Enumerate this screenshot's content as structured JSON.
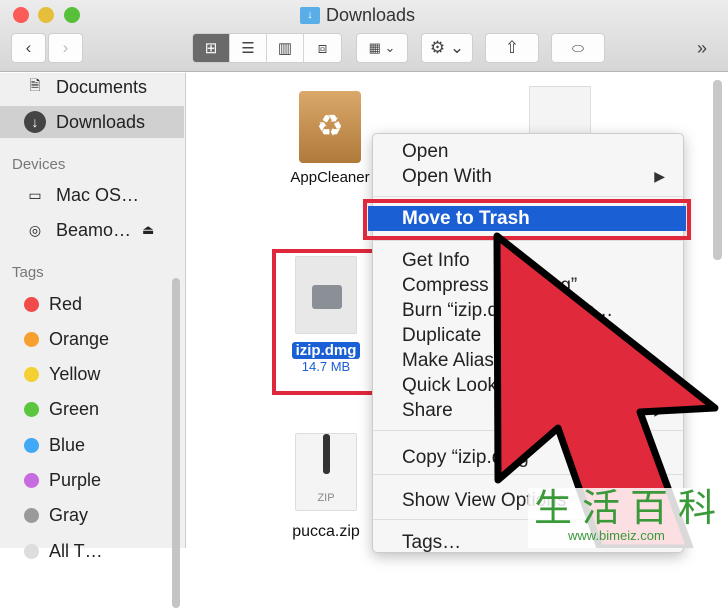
{
  "window": {
    "title": "Downloads",
    "traffic_colors": [
      "#fc5b57",
      "#e5bf3c",
      "#57c038"
    ]
  },
  "toolbar": {
    "back": "‹",
    "forward": "›",
    "views": [
      "icon-view",
      "list-view",
      "column-view",
      "cover-flow-view"
    ],
    "arrange": "arrange-menu",
    "action": "gear-menu",
    "share": "share",
    "tag": "tag",
    "more": "»"
  },
  "sidebar": {
    "favorites": [
      {
        "label": "Documents",
        "icon": "documents-icon"
      },
      {
        "label": "Downloads",
        "icon": "downloads-icon",
        "selected": true
      }
    ],
    "devices_header": "Devices",
    "devices": [
      {
        "label": "Mac OS…",
        "icon": "hard-drive-icon"
      },
      {
        "label": "Beamo…",
        "icon": "disc-icon",
        "eject": true
      }
    ],
    "tags_header": "Tags",
    "tags": [
      {
        "label": "Red",
        "color": "#f04a4a"
      },
      {
        "label": "Orange",
        "color": "#f7a030"
      },
      {
        "label": "Yellow",
        "color": "#f5d033"
      },
      {
        "label": "Green",
        "color": "#5cc640"
      },
      {
        "label": "Blue",
        "color": "#3fa9f5"
      },
      {
        "label": "Purple",
        "color": "#c86be0"
      },
      {
        "label": "Gray",
        "color": "#9a9a9a"
      },
      {
        "label": "All T…",
        "color": "#dddddd"
      }
    ]
  },
  "files": [
    {
      "name": "AppCleaner"
    },
    {
      "name": "izip.dmg",
      "size": "14.7 MB",
      "selected": true
    },
    {
      "name": "pucca.zip",
      "badge": "ZIP"
    }
  ],
  "context_menu": {
    "items": [
      {
        "label": "Open"
      },
      {
        "label": "Open With",
        "submenu": true
      },
      {
        "label": "Move to Trash",
        "highlighted": true
      },
      {
        "label": "Get Info"
      },
      {
        "label": "Compress “izip.dmg”"
      },
      {
        "label": "Burn “izip.dmg” to Disc…"
      },
      {
        "label": "Duplicate"
      },
      {
        "label": "Make Alias"
      },
      {
        "label": "Quick Look “izip.dmg”"
      },
      {
        "label": "Share",
        "submenu": true
      },
      {
        "label": "Copy “izip.dmg”"
      },
      {
        "label": "Show View Options"
      },
      {
        "label": "Tags…"
      }
    ]
  },
  "annotation": {
    "arrow_color": "#e02a3c",
    "watermark": "生活百科",
    "watermark_url": "www.bimeiz.com"
  }
}
